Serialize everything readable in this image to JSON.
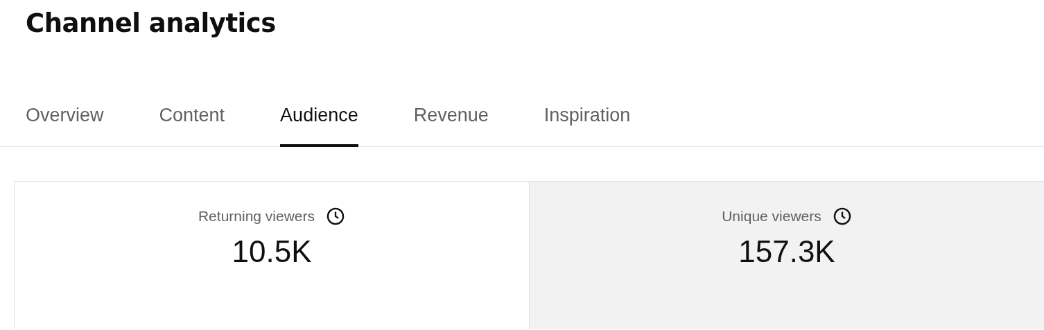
{
  "title": "Channel analytics",
  "tabs": [
    {
      "label": "Overview",
      "selected": false
    },
    {
      "label": "Content",
      "selected": false
    },
    {
      "label": "Audience",
      "selected": true
    },
    {
      "label": "Revenue",
      "selected": false
    },
    {
      "label": "Inspiration",
      "selected": false
    }
  ],
  "metrics": [
    {
      "label": "Returning viewers",
      "value": "10.5K",
      "selected": true
    },
    {
      "label": "Unique viewers",
      "value": "157.3K",
      "selected": false
    }
  ]
}
